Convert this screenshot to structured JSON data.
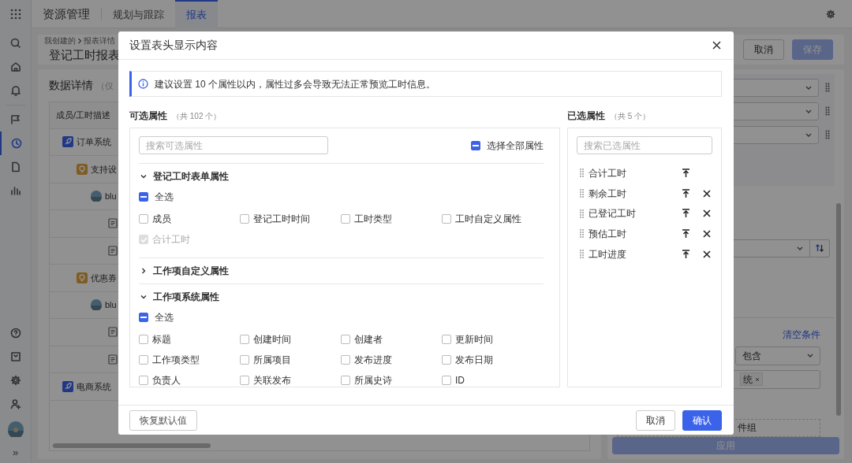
{
  "rail": {
    "items": [
      {
        "selected": false
      },
      {
        "selected": false
      },
      {
        "selected": false
      },
      {
        "selected": false
      },
      {
        "selected": true
      },
      {
        "selected": false
      },
      {
        "selected": false
      }
    ],
    "expand": "»"
  },
  "top_tabs": [
    {
      "label": "资源管理",
      "selected": false
    },
    {
      "label": "规划与跟踪",
      "selected": false
    },
    {
      "label": "报表",
      "selected": true
    }
  ],
  "page": {
    "breadcrumb": [
      "我创建的",
      "报表详情"
    ],
    "title": "登记工时报表",
    "buttons": [
      {
        "label": "取消",
        "kind": "secondary"
      },
      {
        "label": "保存",
        "kind": "primary"
      }
    ]
  },
  "data_panel": {
    "title": "数据详情",
    "note": "（仅",
    "column": "成员/工时描述",
    "rows": [
      {
        "kind": "project",
        "text": "订单系统",
        "children": [
          {
            "kind": "idea",
            "text": "支持设",
            "children": [
              {
                "kind": "member",
                "text": "blu",
                "children": [
                  {
                    "kind": "entry"
                  },
                  {
                    "kind": "entry"
                  }
                ]
              }
            ]
          },
          {
            "kind": "idea",
            "text": "优惠券",
            "children": [
              {
                "kind": "member",
                "text": "blu",
                "children": [
                  {
                    "kind": "entry"
                  },
                  {
                    "kind": "entry"
                  }
                ]
              }
            ]
          }
        ]
      },
      {
        "kind": "project",
        "text": "电商系统"
      }
    ]
  },
  "side_panel": {
    "clear_link": "清空条件",
    "operator": "包含",
    "tag": "统",
    "add_group": "件组",
    "apply": "应用"
  },
  "dialog": {
    "title": "设置表头显示内容",
    "notice": "建议设置 10 个属性以内，属性过多会导致无法正常预览工时信息。",
    "available": {
      "title": "可选属性",
      "count": "（共 102 个）",
      "placeholder": "搜索可选属性",
      "select_all": {
        "label": "选择全部属性",
        "indeterminate": true
      },
      "groups": [
        {
          "title": "登记工时表单属性",
          "expanded": true,
          "select_all": {
            "label": "全选",
            "indeterminate": true
          },
          "options": [
            {
              "label": "成员",
              "checked": false,
              "disabled": false
            },
            {
              "label": "登记工时时间",
              "checked": false,
              "disabled": false
            },
            {
              "label": "工时类型",
              "checked": false,
              "disabled": false
            },
            {
              "label": "工时自定义属性",
              "checked": false,
              "disabled": false
            },
            {
              "label": "合计工时",
              "checked": true,
              "disabled": true
            }
          ]
        },
        {
          "title": "工作项自定义属性",
          "expanded": false
        },
        {
          "title": "工作项系统属性",
          "expanded": true,
          "select_all": {
            "label": "全选",
            "indeterminate": true
          },
          "options": [
            {
              "label": "标题",
              "checked": false,
              "disabled": false
            },
            {
              "label": "创建时间",
              "checked": false,
              "disabled": false
            },
            {
              "label": "创建者",
              "checked": false,
              "disabled": false
            },
            {
              "label": "更新时间",
              "checked": false,
              "disabled": false
            },
            {
              "label": "工作项类型",
              "checked": false,
              "disabled": false
            },
            {
              "label": "所属项目",
              "checked": false,
              "disabled": false
            },
            {
              "label": "发布进度",
              "checked": false,
              "disabled": false
            },
            {
              "label": "发布日期",
              "checked": false,
              "disabled": false
            },
            {
              "label": "负责人",
              "checked": false,
              "disabled": false
            },
            {
              "label": "关联发布",
              "checked": false,
              "disabled": false
            },
            {
              "label": "所属史诗",
              "checked": false,
              "disabled": false
            },
            {
              "label": "ID",
              "checked": false,
              "disabled": false
            }
          ]
        }
      ]
    },
    "chosen": {
      "title": "已选属性",
      "count": "（共 5 个）",
      "placeholder": "搜索已选属性",
      "items": [
        {
          "label": "合计工时",
          "removable": false
        },
        {
          "label": "剩余工时",
          "removable": true
        },
        {
          "label": "已登记工时",
          "removable": true
        },
        {
          "label": "预估工时",
          "removable": true
        },
        {
          "label": "工时进度",
          "removable": true
        }
      ]
    },
    "footer": {
      "reset": "恢复默认值",
      "cancel": "取消",
      "confirm": "确认"
    }
  }
}
